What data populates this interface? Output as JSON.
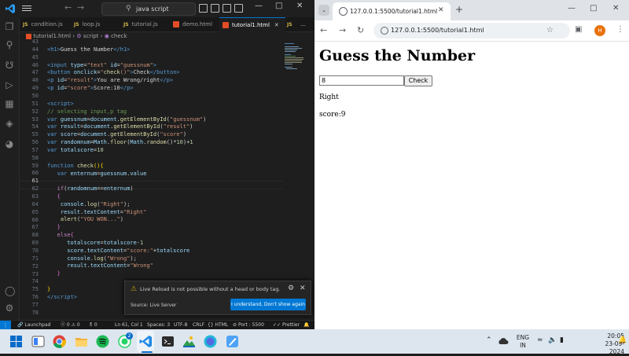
{
  "vscode": {
    "search_text": "java script",
    "tabs": [
      {
        "kind": "js",
        "label": "condition.js"
      },
      {
        "kind": "js",
        "label": "loop.js"
      },
      {
        "kind": "js",
        "label": "tutorial.js"
      },
      {
        "kind": "html",
        "label": "demo.html"
      },
      {
        "kind": "html",
        "label": "tutorial1.html",
        "active": true
      },
      {
        "kind": "js",
        "label": "JS"
      }
    ],
    "breadcrumb": [
      "tutorial1.html",
      "script",
      "check"
    ],
    "lines": [
      "43",
      "44",
      "45",
      "46",
      "47",
      "48",
      "49",
      "50",
      "51",
      "52",
      "53",
      "54",
      "55",
      "56",
      "57",
      "58",
      "59",
      "60",
      "61",
      "62",
      "63",
      "64",
      "65",
      "66",
      "67",
      "68",
      "69",
      "70",
      "71",
      "72",
      "73",
      "74",
      "75",
      "76",
      "77",
      "78"
    ],
    "notification": {
      "message": "Live Reload is not possible without a head or body tag.",
      "source": "Source: Live Server",
      "button": "I understand, Don't show again"
    },
    "status": {
      "launchpad": "Launchpad",
      "problems": "ⓧ 0 ⚠ 0",
      "ports": "⚨ 0",
      "cursor": "Ln 61, Col 1",
      "spaces": "Spaces: 3",
      "encoding": "UTF-8",
      "eol": "CRLF",
      "language": "HTML",
      "port": "Port : 5500",
      "prettier": "Prettier"
    }
  },
  "browser": {
    "tab_title": "127.0.0.1:5500/tutorial1.html",
    "url": "127.0.0.1:5500/tutorial1.html",
    "avatar": "H",
    "page": {
      "heading": "Guess the Number",
      "input_value": "8",
      "button_label": "Check",
      "result": "Right",
      "score": "score:9"
    }
  },
  "taskbar": {
    "lang_top": "ENG",
    "lang_bottom": "IN",
    "time": "20:05",
    "date": "23-09-2024",
    "whatsapp_badge": "2"
  }
}
